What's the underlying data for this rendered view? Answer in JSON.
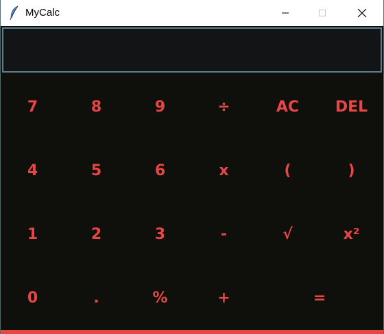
{
  "window": {
    "title": "MyCalc",
    "app_icon": "feather-icon"
  },
  "display": {
    "value": ""
  },
  "colors": {
    "key_text": "#e84545",
    "background": "#0f0f0b",
    "display_border": "#5f7f93",
    "accent_bar": "#e84545"
  },
  "keys": {
    "seven": "7",
    "eight": "8",
    "nine": "9",
    "divide": "÷",
    "clear": "AC",
    "delete": "DEL",
    "four": "4",
    "five": "5",
    "six": "6",
    "multiply": "x",
    "open_paren": "(",
    "close_paren": ")",
    "one": "1",
    "two": "2",
    "three": "3",
    "subtract": "-",
    "sqrt": "√",
    "square": "x²",
    "zero": "0",
    "decimal": ".",
    "percent": "%",
    "add": "+",
    "equals": "="
  }
}
